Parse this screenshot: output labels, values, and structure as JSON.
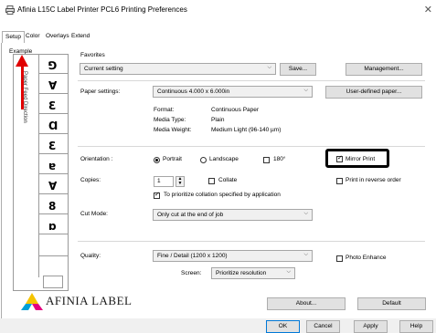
{
  "window": {
    "title": "Afinia L15C Label Printer PCL6 Printing Preferences",
    "close_icon": "close-icon"
  },
  "tabs": [
    {
      "label": "Setup",
      "active": true
    },
    {
      "label": "Color",
      "active": false
    },
    {
      "label": "Overlays",
      "active": false
    },
    {
      "label": "Extend",
      "active": false
    }
  ],
  "example": {
    "label": "Example",
    "feed_direction": "Paper Feed Direction",
    "glyphs": [
      "⅁",
      "Ɐ",
      "Ɛ",
      "Ɑ",
      "Ɛ",
      "ɐ",
      "Ɐ",
      "8",
      "ɒ"
    ]
  },
  "favorites": {
    "label": "Favorites",
    "value": "Current setting",
    "save_label": "Save...",
    "management_label": "Management..."
  },
  "paper": {
    "label": "Paper settings:",
    "value": "Continuous 4.000 x 6.000in",
    "user_defined_label": "User-defined paper...",
    "format_label": "Format:",
    "format_value": "Continuous Paper",
    "media_type_label": "Media Type:",
    "media_type_value": "Plain",
    "media_weight_label": "Media Weight:",
    "media_weight_value": "Medium Light (96-140 µm)"
  },
  "orientation": {
    "label": "Orientation :",
    "portrait": "Portrait",
    "landscape": "Landscape",
    "rotate180": "180°",
    "mirror_print": "Mirror Print"
  },
  "copies": {
    "label": "Copies:",
    "value": "1",
    "collate": "Collate",
    "reverse_order": "Print in reverse order",
    "prioritize": "To prioritize collation specified by application"
  },
  "cut_mode": {
    "label": "Cut Mode:",
    "value": "Only cut at the end of job"
  },
  "quality": {
    "label": "Quality:",
    "value": "Fine / Detail (1200 x 1200)",
    "photo_enhance": "Photo Enhance",
    "screen_label": "Screen:",
    "screen_value": "Prioritize resolution"
  },
  "brand": {
    "name": "AFINIA LABEL"
  },
  "buttons": {
    "about": "About...",
    "default": "Default",
    "ok": "OK",
    "cancel": "Cancel",
    "apply": "Apply",
    "help": "Help"
  },
  "colors": {
    "arrow": "#e00000",
    "highlight_border": "#000000",
    "logo_cyan": "#00a0d8",
    "logo_magenta": "#e4007f",
    "logo_yellow": "#f5c400"
  }
}
